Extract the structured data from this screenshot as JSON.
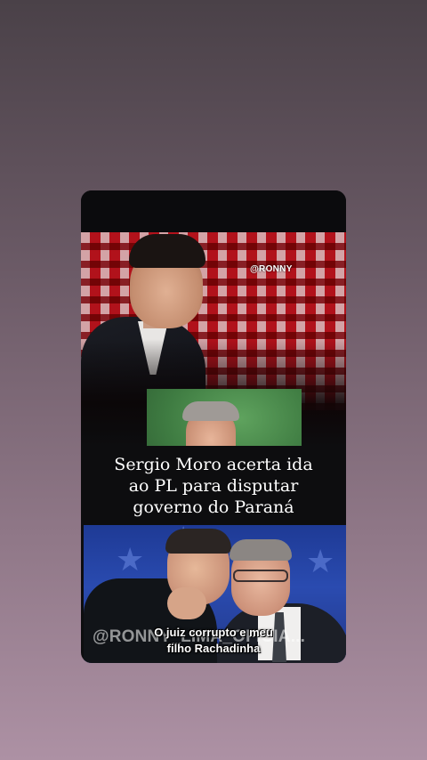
{
  "post": {
    "watermark_small": "@RONNY",
    "headline": [
      "Sergio Moro acerta ida",
      "ao PL para disputar",
      "governo do Paraná"
    ],
    "overlay_handle": "@RONNY_LIMA_OFICIA...",
    "caption": [
      "O juiz corrupto e meu",
      "filho Rachadinha"
    ]
  },
  "colors": {
    "background_top": "#4a4148",
    "background_bottom": "#ad91a4",
    "card": "#0d0d0f",
    "headline_text": "#ffffff",
    "bottom_photo_blue": "#2a4bb0"
  }
}
